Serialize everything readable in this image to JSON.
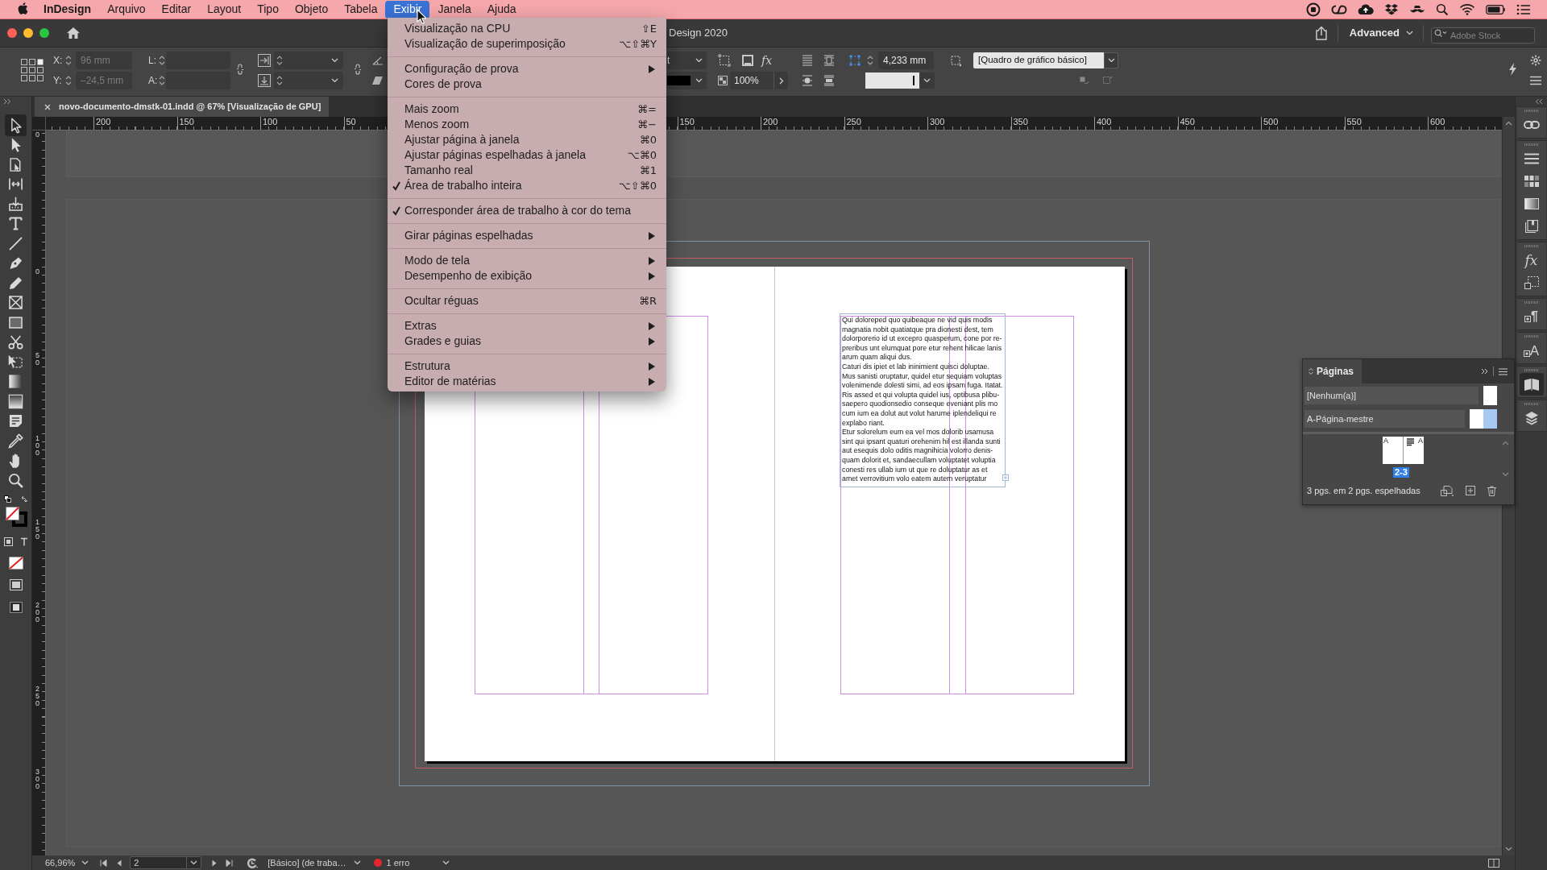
{
  "menu_bar": {
    "app_name": "InDesign",
    "menus": [
      {
        "label": "Arquivo",
        "selected": false
      },
      {
        "label": "Editar",
        "selected": false
      },
      {
        "label": "Layout",
        "selected": false
      },
      {
        "label": "Tipo",
        "selected": false
      },
      {
        "label": "Objeto",
        "selected": false
      },
      {
        "label": "Tabela",
        "selected": false
      },
      {
        "label": "Exibir",
        "selected": true
      },
      {
        "label": "Janela",
        "selected": false
      },
      {
        "label": "Ajuda",
        "selected": false
      }
    ]
  },
  "title_bar": {
    "title": "Design 2020",
    "workspace": "Advanced",
    "search": {
      "placeholder": "Adobe Stock"
    }
  },
  "control_panel": {
    "x": {
      "label": "X:",
      "value": "96 mm",
      "disabled": true
    },
    "y": {
      "label": "Y:",
      "value": "–24,5 mm",
      "disabled": true
    },
    "width": {
      "label": "L:"
    },
    "height": {
      "label": "A:"
    },
    "stroke_type": "t",
    "effects": "fx",
    "opacity": "100%",
    "stroke_weight": "4,233 mm",
    "object_style": "[Quadro de gráfico básico]"
  },
  "toolbar": {
    "tools": [
      {
        "selected": true
      },
      {
        "selected": false
      },
      {
        "selected": false
      },
      {
        "selected": false
      },
      {
        "selected": false
      },
      {
        "selected": false
      },
      {
        "selected": false
      },
      {
        "selected": false
      },
      {
        "selected": false
      },
      {
        "selected": false
      },
      {
        "selected": false
      },
      {
        "selected": false
      },
      {
        "selected": false
      },
      {
        "selected": false
      },
      {
        "selected": false
      },
      {
        "selected": false
      },
      {
        "selected": false
      },
      {
        "selected": false
      },
      {
        "selected": false
      }
    ]
  },
  "document_tabs": [
    {
      "title": "novo-documento-dmstk-01.indd @ 67% [Visualização de GPU]",
      "selected": true
    }
  ],
  "rulers": {
    "horizontal": [
      "200",
      "150",
      "100",
      "50",
      "150",
      "200",
      "250",
      "300",
      "350",
      "400",
      "450",
      "500",
      "550",
      "600"
    ],
    "vertical": [
      "0",
      "0",
      "50",
      "100",
      "150",
      "200",
      "250",
      "300"
    ]
  },
  "document": {
    "paragraphs": [
      "Qui doloreped quo quibeaque ne vid quis modis\nmagnatia nobit quatiatque pra dionesti dest, tem\ndolorporerio id ut excepro quasperum, cone por re-\npreribus unt elumquat pore etur rehent hilicae lanis\narum quam aliqui dus.",
      "Caturi dis ipiet et lab ininimient quisci doluptae.\nMus sanisti oruptatur, quidel etur sequiam voluptas\nvolenimende dolesti simi, ad eos ipsam fuga. Itatat.\nRis assed et qui volupta quidel ius, optibusa plibu-\nsaepero quodionsedio conseque eveniant plis mo\ncum ium ea dolut aut volut harume iplendeliqui re\nexplabo riant.",
      "Etur solorelum eum ea vel mos dolorib usamusa\nsint qui ipsant quaturi orehenim hil est illanda sunti\naut esequis dolo oditis magnihicia volorro denis-\nquam dolorit et, sandaecullam voluptatet voluptia\nconesti res ullab ium ut que re doluptatur as et\namet verrovitium volo eatem autem veruptatur"
    ]
  },
  "view_menu": {
    "groups": [
      [
        {
          "label": "Visualização na CPU",
          "shortcut": "⇧E",
          "checked": false,
          "submenu": false
        },
        {
          "label": "Visualização de superimposição",
          "shortcut": "⌥⇧⌘Y",
          "checked": false,
          "submenu": false
        }
      ],
      [
        {
          "label": "Configuração de prova",
          "checked": false,
          "submenu": true
        },
        {
          "label": "Cores de prova",
          "checked": false,
          "submenu": false
        }
      ],
      [
        {
          "label": "Mais zoom",
          "shortcut": "⌘=",
          "checked": false,
          "submenu": false
        },
        {
          "label": "Menos zoom",
          "shortcut": "⌘−",
          "checked": false,
          "submenu": false
        },
        {
          "label": "Ajustar página à janela",
          "shortcut": "⌘0",
          "checked": false,
          "submenu": false
        },
        {
          "label": "Ajustar páginas espelhadas à janela",
          "shortcut": "⌥⌘0",
          "checked": false,
          "submenu": false
        },
        {
          "label": "Tamanho real",
          "shortcut": "⌘1",
          "checked": false,
          "submenu": false
        },
        {
          "label": "Área de trabalho inteira",
          "shortcut": "⌥⇧⌘0",
          "checked": true,
          "submenu": false
        }
      ],
      [
        {
          "label": "Corresponder área de trabalho à cor do tema",
          "checked": true,
          "submenu": false
        }
      ],
      [
        {
          "label": "Girar páginas espelhadas",
          "checked": false,
          "submenu": true
        }
      ],
      [
        {
          "label": "Modo de tela",
          "checked": false,
          "submenu": true
        },
        {
          "label": "Desempenho de exibição",
          "checked": false,
          "submenu": true
        }
      ],
      [
        {
          "label": "Ocultar réguas",
          "shortcut": "⌘R",
          "checked": false,
          "submenu": false
        }
      ],
      [
        {
          "label": "Extras",
          "checked": false,
          "submenu": true
        },
        {
          "label": "Grades e guias",
          "checked": false,
          "submenu": true
        }
      ],
      [
        {
          "label": "Estrutura",
          "checked": false,
          "submenu": true
        },
        {
          "label": "Editor de matérias",
          "checked": false,
          "submenu": true
        }
      ]
    ]
  },
  "pages_panel": {
    "title": "Páginas",
    "masters": [
      {
        "name": "[Nenhum(a)]"
      },
      {
        "name": "A-Página-mestre"
      }
    ],
    "spreads": [
      {
        "left_prefix": "A",
        "right_prefix": "A",
        "label": "2-3",
        "selected": true
      }
    ],
    "summary": "3 pgs. em 2 pgs. espelhadas"
  },
  "right_dock": {
    "effects": "fx",
    "paragraph_styles": "¶",
    "character_styles": "A"
  },
  "status_bar": {
    "zoom": "66,96%",
    "page": "2",
    "preflight_profile": "[Básico] (de traba…",
    "errors": "1 erro"
  }
}
